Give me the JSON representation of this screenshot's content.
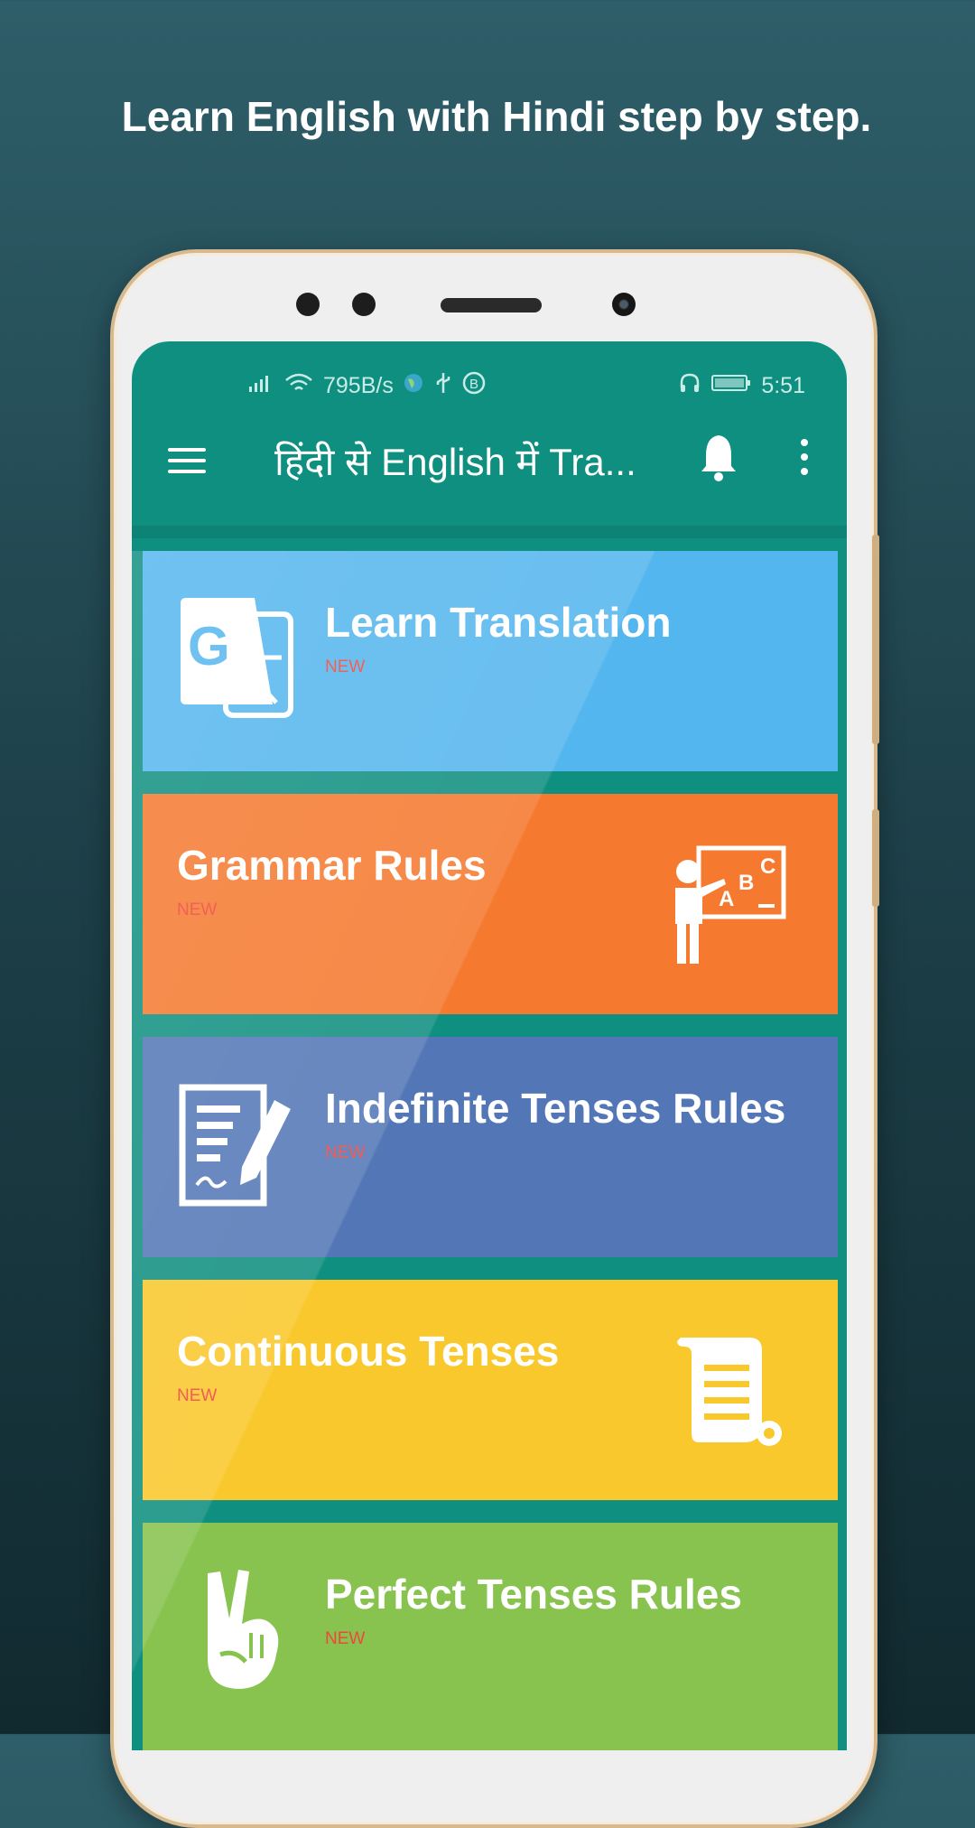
{
  "promo": {
    "headline": "Learn English with Hindi step by step."
  },
  "status_bar": {
    "speed": "795B/s",
    "time": "5:51"
  },
  "app_bar": {
    "title": "हिंदी से English में Tra..."
  },
  "menu_cards": [
    {
      "title": "Learn Translation",
      "badge": "NEW",
      "color": "#54b6ee",
      "icon": "google-translate-icon"
    },
    {
      "title": "Grammar Rules",
      "badge": "NEW",
      "color": "#f5792f",
      "icon": "teacher-board-icon"
    },
    {
      "title": "Indefinite Tenses Rules",
      "badge": "NEW",
      "color": "#5377b6",
      "icon": "document-pen-icon"
    },
    {
      "title": "Continuous Tenses",
      "badge": "NEW",
      "color": "#f9c82c",
      "icon": "scroll-icon"
    },
    {
      "title": "Perfect Tenses Rules",
      "badge": "NEW",
      "color": "#88c34f",
      "icon": "victory-hand-icon"
    }
  ],
  "colors": {
    "app_teal": "#0f8f80",
    "badge_red": "#f0463c"
  }
}
